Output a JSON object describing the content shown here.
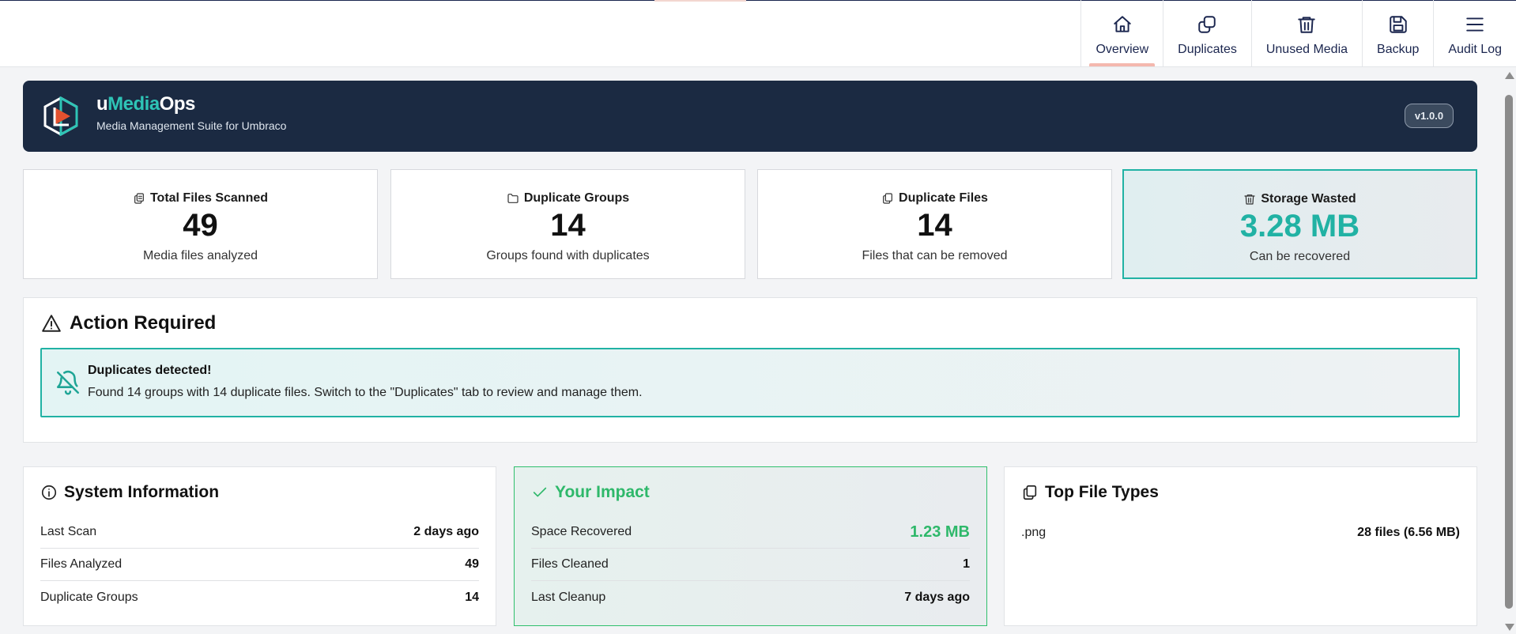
{
  "nav": {
    "tabs": [
      {
        "label": "Overview",
        "icon": "home-icon"
      },
      {
        "label": "Duplicates",
        "icon": "copy-icon"
      },
      {
        "label": "Unused Media",
        "icon": "trash-icon"
      },
      {
        "label": "Backup",
        "icon": "save-icon"
      },
      {
        "label": "Audit Log",
        "icon": "menu-icon"
      }
    ],
    "active_tab": "Overview"
  },
  "brand": {
    "name_prefix": "u",
    "name_accent": "Media",
    "name_suffix": "Ops",
    "subtitle": "Media Management Suite for Umbraco",
    "version": "v1.0.0",
    "logo_icon": "umediaops-logo-icon"
  },
  "stats": [
    {
      "title": "Total Files Scanned",
      "value": "49",
      "desc": "Media files analyzed",
      "icon": "files-icon"
    },
    {
      "title": "Duplicate Groups",
      "value": "14",
      "desc": "Groups found with duplicates",
      "icon": "folder-icon"
    },
    {
      "title": "Duplicate Files",
      "value": "14",
      "desc": "Files that can be removed",
      "icon": "copy-icon"
    },
    {
      "title": "Storage Wasted",
      "value": "3.28 MB",
      "desc": "Can be recovered",
      "icon": "trash-icon"
    }
  ],
  "action": {
    "title": "Action Required",
    "alert_title": "Duplicates detected!",
    "alert_text": "Found 14 groups with 14 duplicate files. Switch to the \"Duplicates\" tab to review and manage them."
  },
  "system": {
    "title": "System Information",
    "rows": [
      {
        "label": "Last Scan",
        "value": "2 days ago"
      },
      {
        "label": "Files Analyzed",
        "value": "49"
      },
      {
        "label": "Duplicate Groups",
        "value": "14"
      }
    ]
  },
  "impact": {
    "title": "Your Impact",
    "rows": [
      {
        "label": "Space Recovered",
        "value": "1.23 MB"
      },
      {
        "label": "Files Cleaned",
        "value": "1"
      },
      {
        "label": "Last Cleanup",
        "value": "7 days ago"
      }
    ]
  },
  "filetypes": {
    "title": "Top File Types",
    "rows": [
      {
        "label": ".png",
        "value": "28 files (6.56 MB)"
      }
    ]
  },
  "colors": {
    "brand_bg": "#1b2a42",
    "teal_accent": "#21b2a4",
    "impact_green": "#2eb86a",
    "tab_active_underline": "#f4b8ae"
  }
}
